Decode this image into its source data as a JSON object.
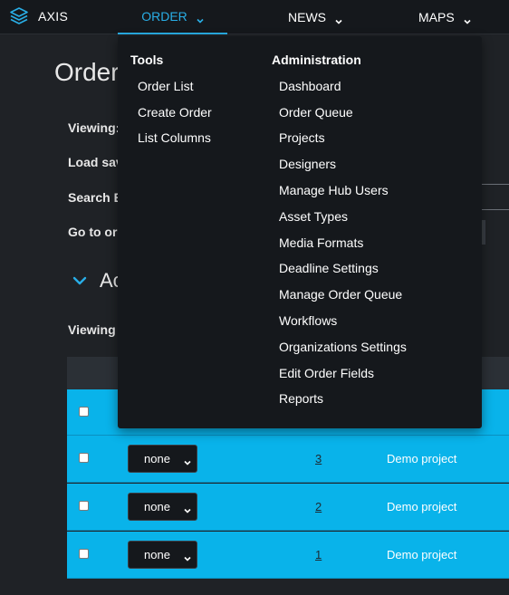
{
  "app": {
    "brand": "AXIS"
  },
  "nav": {
    "items": [
      {
        "label": "ORDER",
        "active": true
      },
      {
        "label": "NEWS",
        "active": false
      },
      {
        "label": "MAPS",
        "active": false
      }
    ]
  },
  "colors": {
    "accent": "#29aee6",
    "row_bg": "#09b3ea",
    "nav_bg": "#15181c",
    "page_bg": "#1f2226"
  },
  "page": {
    "title": "Order",
    "labels": {
      "viewing": "Viewing:",
      "load_saved": "Load sav",
      "search": "Search B",
      "go_to_order": "Go to ord"
    },
    "section_title": "Ac",
    "viewing2": "Viewing"
  },
  "table": {
    "rows": [
      {
        "select": "",
        "order": "",
        "project": ""
      },
      {
        "select": "none",
        "order": "3",
        "project": "Demo project"
      },
      {
        "select": "none",
        "order": "2",
        "project": "Demo project"
      },
      {
        "select": "none",
        "order": "1",
        "project": "Demo project"
      }
    ]
  },
  "dropdown": {
    "tools": {
      "heading": "Tools",
      "items": [
        "Order List",
        "Create Order",
        "List Columns"
      ]
    },
    "administration": {
      "heading": "Administration",
      "items": [
        "Dashboard",
        "Order Queue",
        "Projects",
        "Designers",
        "Manage Hub Users",
        "Asset Types",
        "Media Formats",
        "Deadline Settings",
        "Manage Order Queue",
        "Workflows",
        "Organizations Settings",
        "Edit Order Fields",
        "Reports"
      ]
    }
  },
  "icons": {
    "brand": "stacked-layers-icon",
    "nav_chevron": "chevron-down-icon",
    "section_toggle": "chevron-down-icon"
  }
}
